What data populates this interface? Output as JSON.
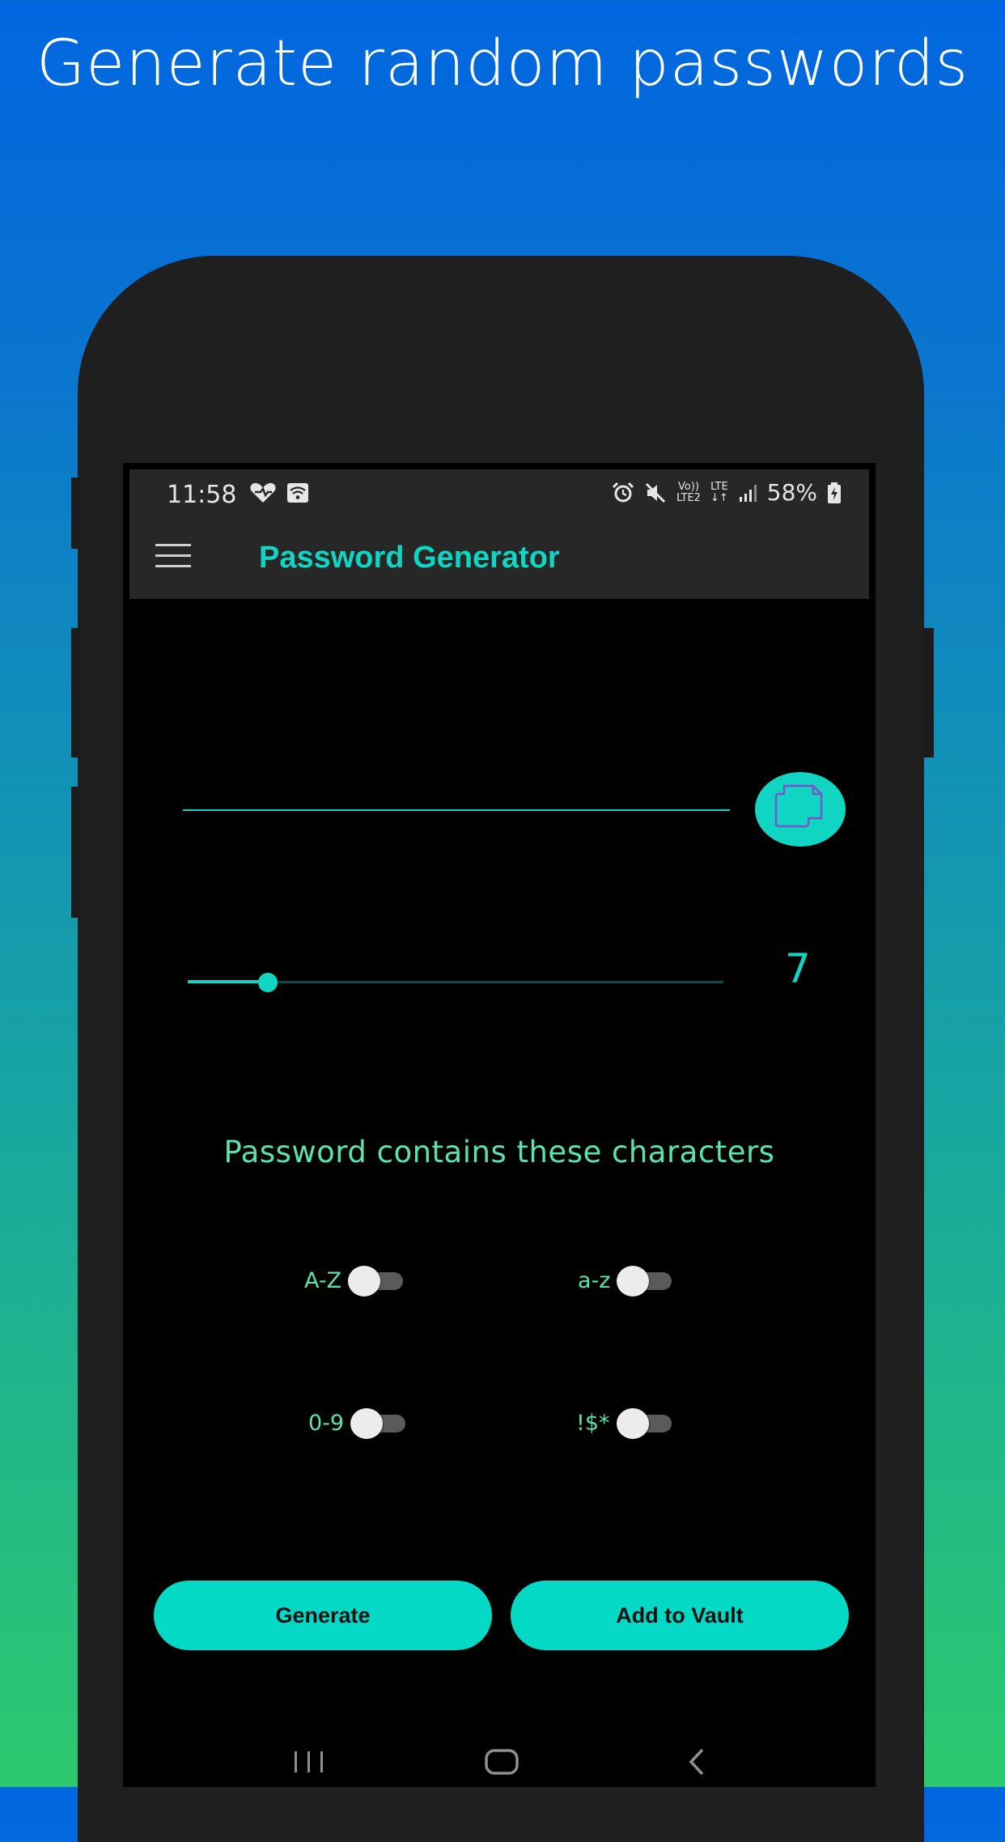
{
  "headline": "Generate random passwords",
  "status_bar": {
    "time": "11:58",
    "left_icons": [
      "heart-check-icon",
      "wifi-calling-icon"
    ],
    "right_icons": [
      "alarm-icon",
      "mute-icon",
      "volte-lte2-icon",
      "lte-data-icon",
      "signal-icon"
    ],
    "volte_top": "Vo))",
    "volte_bottom": "LTE2",
    "lte_top": "LTE",
    "lte_bottom": "↓↑",
    "battery": "58%",
    "battery_icon": "battery-charging-icon"
  },
  "app_bar": {
    "menu_icon": "hamburger-menu-icon",
    "title": "Password Generator"
  },
  "password_field": {
    "value": "",
    "placeholder": ""
  },
  "copy_button": {
    "icon": "copy-icon"
  },
  "length_slider": {
    "value": 7,
    "fraction": 0.15,
    "display": "7"
  },
  "characters_heading": "Password contains these characters",
  "toggles": [
    {
      "label": "A-Z",
      "on": false
    },
    {
      "label": "a-z",
      "on": false
    },
    {
      "label": "0-9",
      "on": false
    },
    {
      "label": "!$*",
      "on": false
    }
  ],
  "buttons": {
    "generate": "Generate",
    "add_to_vault": "Add to Vault"
  },
  "nav_bar": {
    "icons": [
      "recent-apps-icon",
      "home-icon",
      "back-icon"
    ]
  },
  "colors": {
    "accent": "#10d5c2",
    "label_green": "#58e3b4",
    "button_fill": "#04d9c5",
    "background_top": "#0066e0",
    "background_bottom": "#2cc96e",
    "screen_bg": "#000000",
    "appbar_bg": "#272727"
  }
}
